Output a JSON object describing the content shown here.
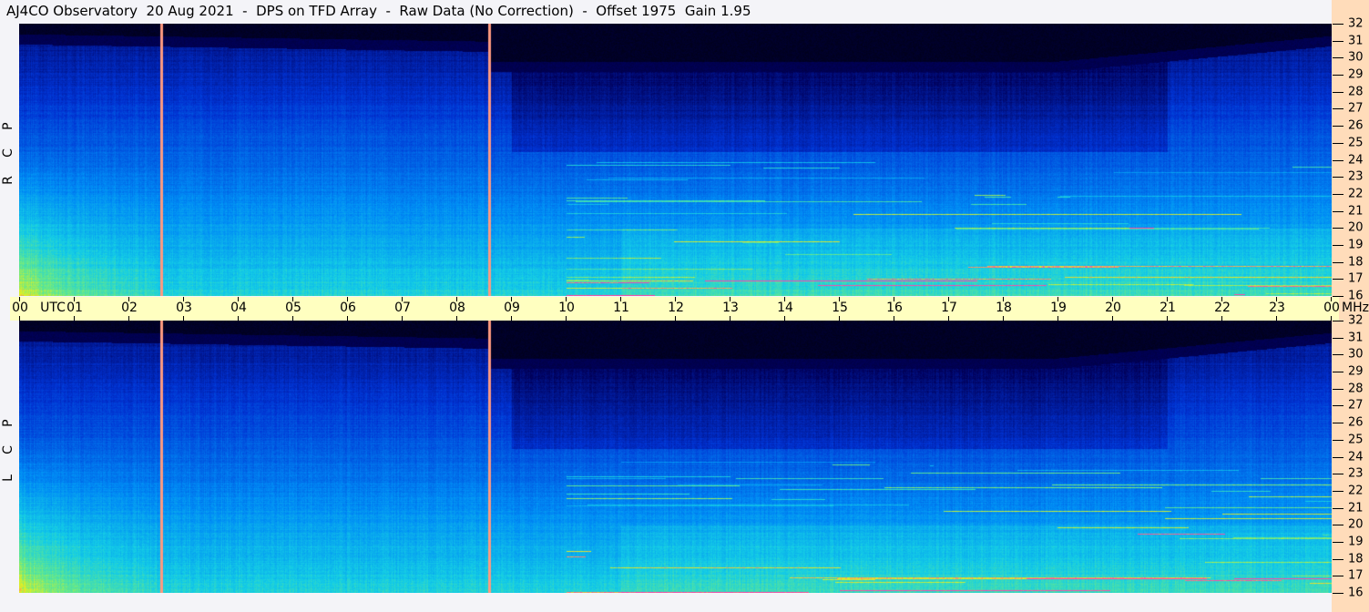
{
  "title": "AJ4CO Observatory  20 Aug 2021  -  DPS on TFD Array  -  Raw Data (No Correction)  -  Offset 1975  Gain 1.95",
  "panels": [
    {
      "label": [
        "R",
        "C",
        "P"
      ],
      "polarization": "RCP"
    },
    {
      "label": [
        "L",
        "C",
        "P"
      ],
      "polarization": "LCP"
    }
  ],
  "time_axis": {
    "hours": [
      "00",
      "01",
      "02",
      "03",
      "04",
      "05",
      "06",
      "07",
      "08",
      "09",
      "10",
      "11",
      "12",
      "13",
      "14",
      "15",
      "16",
      "17",
      "18",
      "19",
      "20",
      "21",
      "22",
      "23",
      "00"
    ],
    "unit_left": "UTC",
    "unit_right": "MHz"
  },
  "freq_axis": {
    "ticks": [
      "32",
      "31",
      "30",
      "29",
      "28",
      "27",
      "26",
      "25",
      "24",
      "23",
      "22",
      "21",
      "20",
      "19",
      "18",
      "17",
      "16"
    ]
  },
  "colors": {
    "marker_line": "#ff9a80",
    "strip": "#ffffc0",
    "right_axis": "#ffdcba"
  },
  "markers_utc": [
    "02:36",
    "08:36"
  ]
}
